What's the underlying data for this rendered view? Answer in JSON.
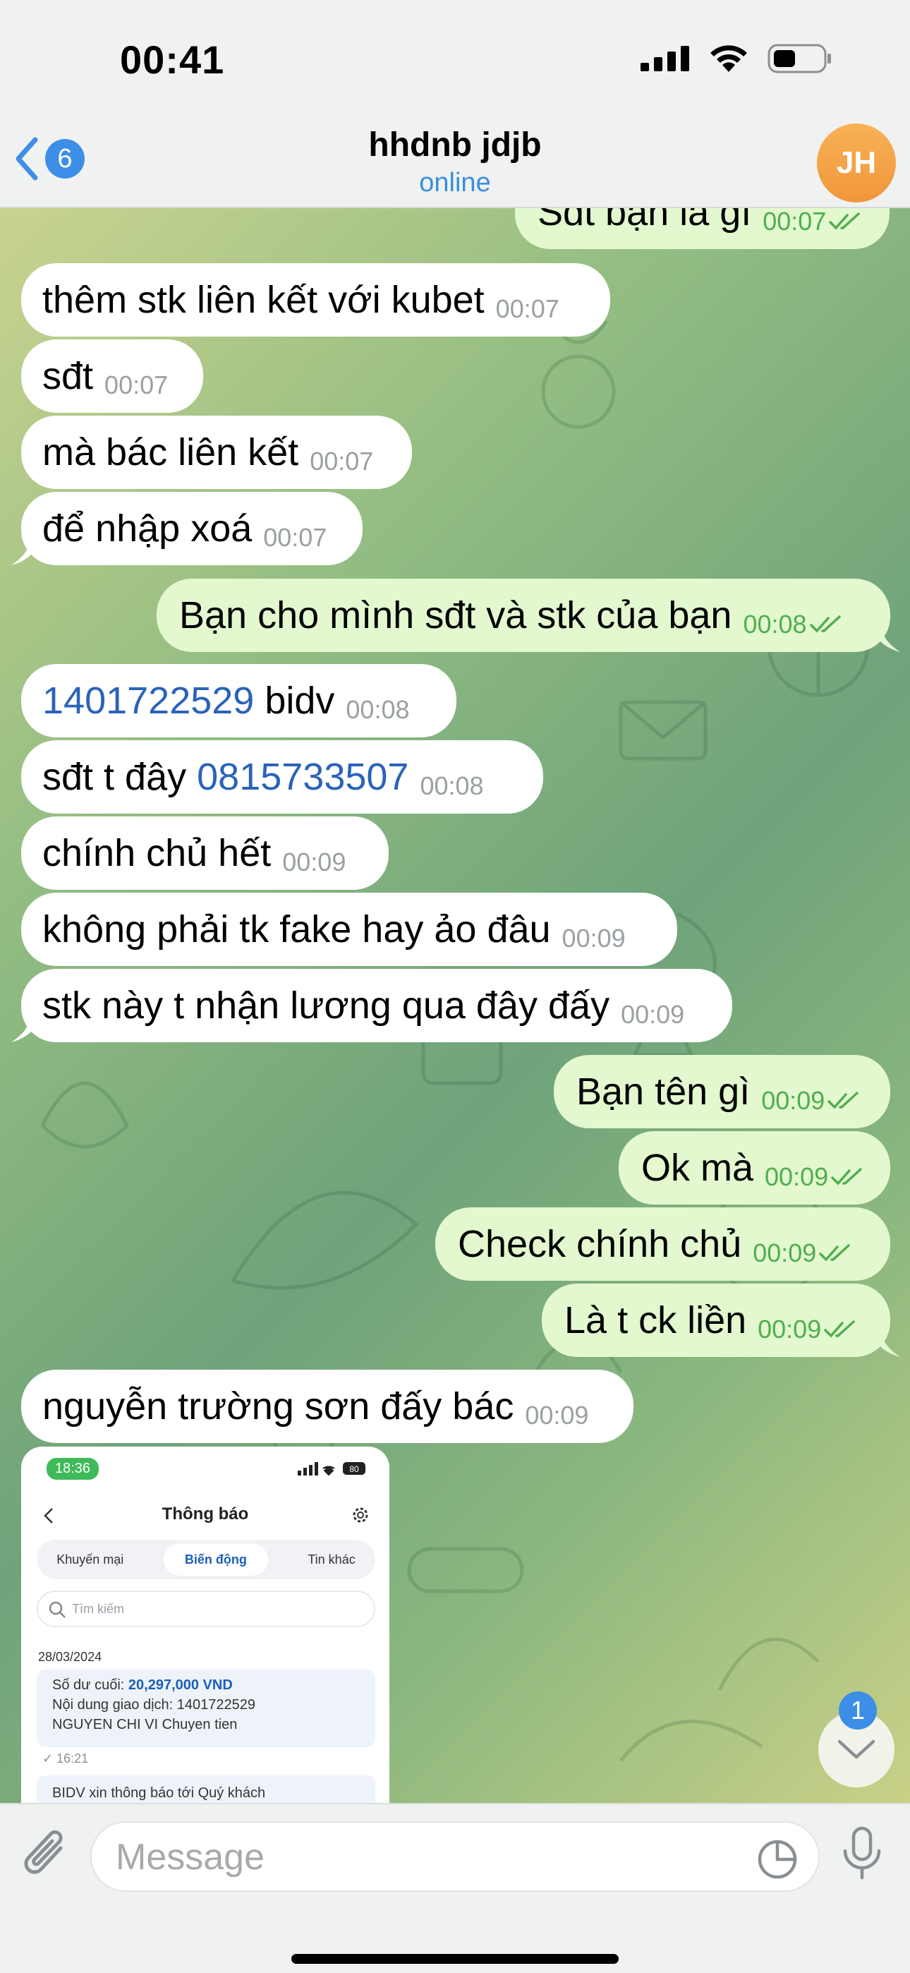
{
  "status_bar": {
    "time": "00:41"
  },
  "header": {
    "back_badge": "6",
    "title": "hhdnb jdjb",
    "subtitle": "online",
    "avatar_initials": "JH"
  },
  "messages": [
    {
      "dir": "out",
      "text": "Sđt bạn là gì",
      "time": "00:07"
    },
    {
      "dir": "in",
      "text": "thêm stk liên kết với kubet",
      "time": "00:07"
    },
    {
      "dir": "in",
      "text": "sđt",
      "time": "00:07"
    },
    {
      "dir": "in",
      "text": "mà bác liên kết",
      "time": "00:07"
    },
    {
      "dir": "in",
      "text": "để nhập xoá",
      "time": "00:07"
    },
    {
      "dir": "out",
      "text": "Bạn cho mình sđt và stk của bạn",
      "time": "00:08"
    },
    {
      "dir": "in",
      "link": "1401722529",
      "text": " bidv",
      "time": "00:08"
    },
    {
      "dir": "in",
      "text": "sđt t đây ",
      "link": "0815733507",
      "time": "00:08"
    },
    {
      "dir": "in",
      "text": "chính chủ hết",
      "time": "00:09"
    },
    {
      "dir": "in",
      "text": "không phải tk fake hay ảo đâu",
      "time": "00:09"
    },
    {
      "dir": "in",
      "text": "stk này t nhận lương qua đây đấy",
      "time": "00:09"
    },
    {
      "dir": "out",
      "text": "Bạn tên gì",
      "time": "00:09"
    },
    {
      "dir": "out",
      "text": "Ok mà",
      "time": "00:09"
    },
    {
      "dir": "out",
      "text": "Check chính chủ",
      "time": "00:09"
    },
    {
      "dir": "out",
      "text": "Là t ck liền",
      "time": "00:09"
    },
    {
      "dir": "in",
      "text": "nguyễn trường sơn đấy bác",
      "time": "00:09"
    }
  ],
  "photo": {
    "time": "18:36",
    "battery": "80",
    "title": "Thông báo",
    "tabs": [
      "Khuyến mại",
      "Biến động",
      "Tin khác"
    ],
    "active_tab": "Biến động",
    "search_placeholder": "Tìm kiếm",
    "date": "28/03/2024",
    "balance_label": "Số dư cuối: ",
    "balance_value": "20,297,000 VND",
    "content_line1": "Nội dung giao dịch: 1401722529",
    "content_line2": "NGUYEN CHI VI Chuyen tien",
    "time2": "16:21",
    "next_card": "BIDV xin thông báo tới Quý khách"
  },
  "scroll_badge": "1",
  "composer": {
    "placeholder": "Message"
  },
  "colors": {
    "accent": "#3d8ee6",
    "outgoing_bubble": "#e3f8cf",
    "incoming_bubble": "#ffffff",
    "link": "#2a63b9",
    "check": "#4fae4e"
  }
}
